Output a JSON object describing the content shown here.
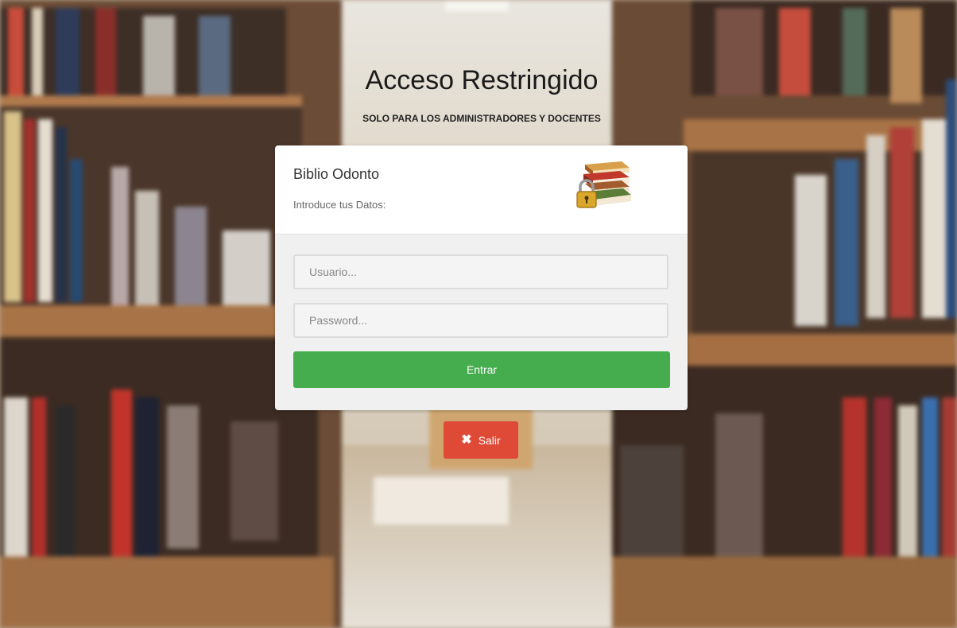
{
  "header": {
    "title": "Acceso Restringido",
    "subtitle": "SOLO PARA LOS ADMINISTRADORES Y DOCENTES"
  },
  "panel": {
    "brand": "Biblio Odonto",
    "hint": "Introduce tus Datos:",
    "logo_icon": "locked-books-icon",
    "username": {
      "value": "",
      "placeholder": "Usuario..."
    },
    "password": {
      "value": "",
      "placeholder": "Password..."
    },
    "submit_label": "Entrar"
  },
  "exit": {
    "label": "Salir",
    "icon": "close-icon"
  },
  "colors": {
    "submit": "#46ad4f",
    "exit": "#df4a37",
    "panel_body": "#f0f0f0"
  }
}
